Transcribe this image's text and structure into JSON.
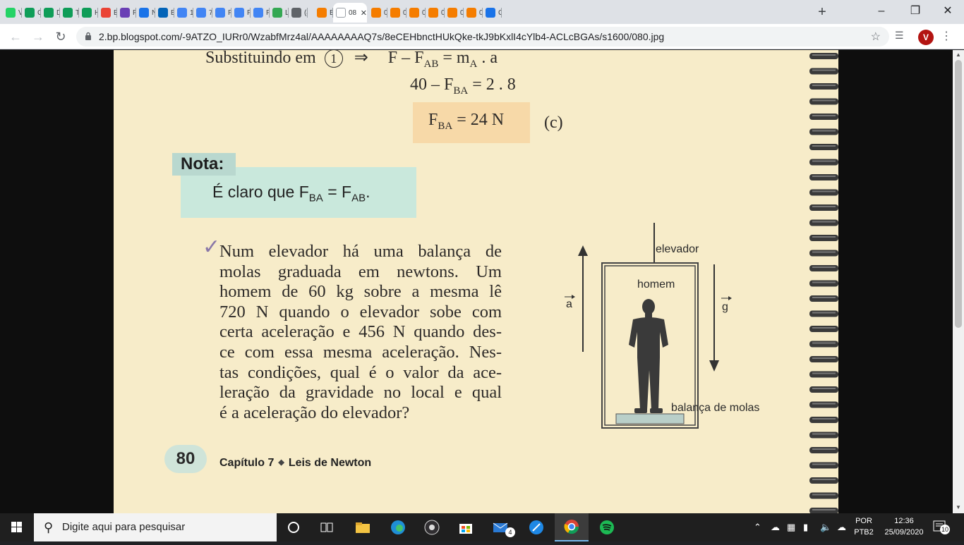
{
  "browser": {
    "tabs": [
      {
        "label": "V",
        "icon": "whatsapp-icon",
        "color": "#25d366"
      },
      {
        "label": "C",
        "icon": "google-sheets-icon",
        "color": "#0f9d58"
      },
      {
        "label": "D",
        "icon": "google-sheets-icon",
        "color": "#0f9d58"
      },
      {
        "label": "T",
        "icon": "google-sheets-icon",
        "color": "#0f9d58"
      },
      {
        "label": "H",
        "icon": "google-sheets-icon",
        "color": "#0f9d58"
      },
      {
        "label": "E",
        "icon": "gmail-icon",
        "color": "#ea4335"
      },
      {
        "label": "P",
        "icon": "purple-app-icon",
        "color": "#6a3fb5"
      },
      {
        "label": "N",
        "icon": "blue-app-icon",
        "color": "#1a73e8"
      },
      {
        "label": "E",
        "icon": "outlook-icon",
        "color": "#0364b8"
      },
      {
        "label": "1",
        "icon": "google-docs-icon",
        "color": "#4285f4"
      },
      {
        "label": "7",
        "icon": "google-docs-icon",
        "color": "#4285f4"
      },
      {
        "label": "P",
        "icon": "google-docs-icon",
        "color": "#4285f4"
      },
      {
        "label": "P",
        "icon": "google-docs-icon",
        "color": "#4285f4"
      },
      {
        "label": "P",
        "icon": "google-docs-icon",
        "color": "#4285f4"
      },
      {
        "label": "L",
        "icon": "map-pin-icon",
        "color": "#34a853"
      },
      {
        "label": "(4",
        "icon": "audio-icon",
        "color": "#5f6368"
      },
      {
        "label": "B",
        "icon": "blogger-icon",
        "color": "#f57d00"
      },
      {
        "label": "08",
        "icon": "blank-page-icon",
        "color": "#ffffff"
      },
      {
        "label": "0",
        "icon": "blogger-icon",
        "color": "#f57d00"
      },
      {
        "label": "0",
        "icon": "blogger-icon",
        "color": "#f57d00"
      },
      {
        "label": "0",
        "icon": "blogger-icon",
        "color": "#f57d00"
      },
      {
        "label": "0",
        "icon": "blogger-icon",
        "color": "#f57d00"
      },
      {
        "label": "0",
        "icon": "blogger-icon",
        "color": "#f57d00"
      },
      {
        "label": "0",
        "icon": "blogger-icon",
        "color": "#f57d00"
      },
      {
        "label": "C",
        "icon": "infinity-icon",
        "color": "#1a73e8"
      }
    ],
    "url": "2.bp.blogspot.com/-9ATZO_IURr0/WzabfMrz4al/AAAAAAAAQ7s/8eCEHbnctHUkQke-tkJ9bKxlI4cYlb4-ACLcBGAs/s1600/080.jpg",
    "profile_initial": "V"
  },
  "page": {
    "eq1": "Substituindo em",
    "eq1_circle": "1",
    "eq1_arrow": "⇒",
    "eq1_rhs": "F – F",
    "eq1_sub_ab": "AB",
    "eq1_mid": " = m",
    "eq1_sub_a": "A",
    "eq1_end": " . a",
    "eq2": "40 – F",
    "eq2_sub": "BA",
    "eq2_end": " = 2 . 8",
    "eq3": "F",
    "eq3_sub": "BA",
    "eq3_end": " = 24 N",
    "eq3_tag": "(c)",
    "nota_label": "Nota:",
    "nota_text_a": "É claro que F",
    "nota_sub_ba": "BA",
    "nota_text_b": " = F",
    "nota_sub_ab": "AB",
    "nota_text_c": ".",
    "problem_lines": [
      "Num elevador há uma balança de",
      "molas graduada em newtons. Um",
      "homem de 60 kg sobre a mesma lê",
      "720 N quando o elevador sobe com",
      "certa aceleração e 456 N quando des-",
      "ce com essa mesma aceleração. Nes-",
      "tas condições, qual é o valor da ace-",
      "leração da gravidade no local e qual",
      "é a aceleração do elevador?"
    ],
    "figure": {
      "elevador": "elevador",
      "homem": "homem",
      "a": "a",
      "g": "g",
      "balanca": "balança de molas"
    },
    "page_number": "80",
    "chapter": "Capítulo 7",
    "chapter_title": "Leis de Newton"
  },
  "taskbar": {
    "search_placeholder": "Digite aqui para pesquisar",
    "lang_line1": "POR",
    "lang_line2": "PTB2",
    "time": "12:36",
    "date": "25/09/2020",
    "notification_count": "10",
    "mail_badge": "4"
  }
}
